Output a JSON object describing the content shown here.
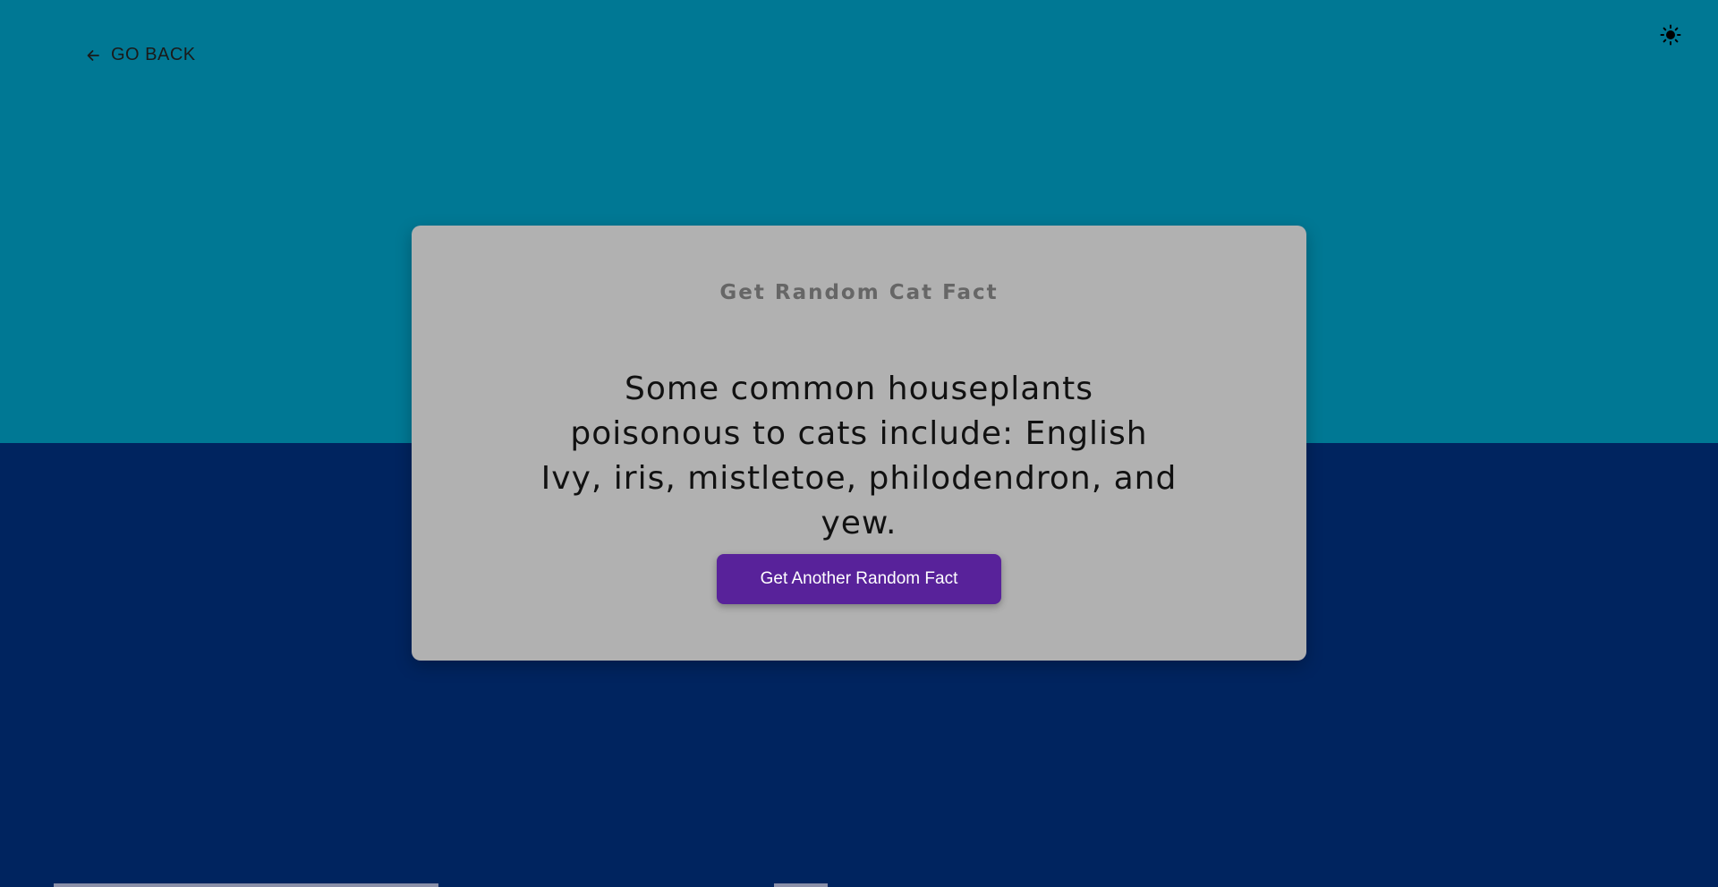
{
  "colors": {
    "top_background": "#007894",
    "bottom_background": "#00245f",
    "card_background": "#b1b1b1",
    "button_background": "#58229a",
    "button_text": "#ffffff"
  },
  "nav": {
    "back_label": "GO BACK",
    "back_icon": "arrow-left-icon",
    "theme_icon": "sun-icon"
  },
  "card": {
    "title": "Get Random Cat Fact",
    "fact": "Some common houseplants poisonous to cats include: English Ivy, iris, mistletoe, philodendron, and yew.",
    "button_label": "Get Another Random Fact"
  }
}
